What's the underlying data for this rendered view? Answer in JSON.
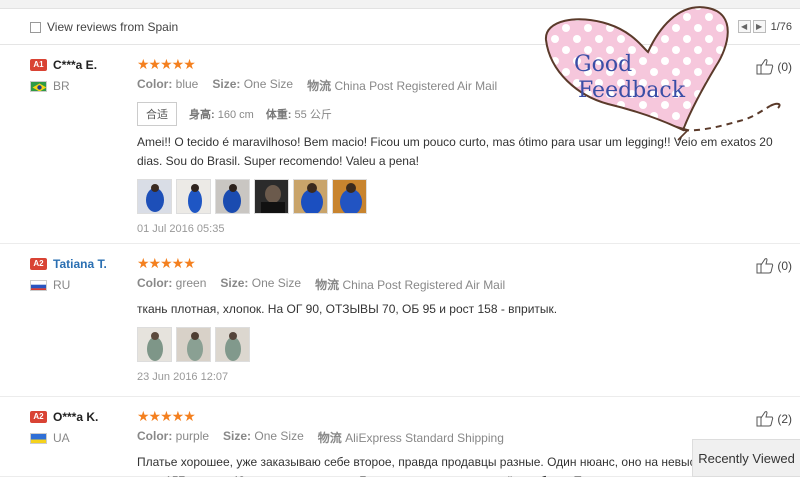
{
  "toolbar": {
    "filter_label": "View reviews from Spain",
    "pager": {
      "prev": "◀",
      "next": "▶",
      "info": "1/76"
    }
  },
  "overlay": {
    "line1": "Good",
    "line2": "Feedback"
  },
  "reviews": [
    {
      "level": "A1",
      "name": "C***a E.",
      "country": "BR",
      "stars": "★★★★★",
      "color_label": "Color:",
      "color_value": "blue",
      "size_label": "Size:",
      "size_value": "One Size",
      "logistics_label": "物流",
      "logistics_value": "China Post Registered Air Mail",
      "fit": "合适",
      "height_label": "身高:",
      "height_value": "160 cm",
      "weight_label": "体重:",
      "weight_value": "55 公斤",
      "text": "Amei!! O tecido é maravilhoso! Bem macio! Ficou um pouco curto, mas ótimo para usar um legging!! Veio em exatos 20 dias. Sou do Brasil. Super recomendo! Valeu a pena!",
      "date": "01 Jul 2016 05:35",
      "helpful": "(0)"
    },
    {
      "level": "A2",
      "name": "Tatiana T.",
      "country": "RU",
      "stars": "★★★★★",
      "color_label": "Color:",
      "color_value": "green",
      "size_label": "Size:",
      "size_value": "One Size",
      "logistics_label": "物流",
      "logistics_value": "China Post Registered Air Mail",
      "text": "ткань плотная, хлопок. На ОГ 90, ОТЗЫВЫ 70, ОБ 95 и рост 158 - впритык.",
      "date": "23 Jun 2016 12:07",
      "helpful": "(0)"
    },
    {
      "level": "A2",
      "name": "O***a K.",
      "country": "UA",
      "stars": "★★★★★",
      "color_label": "Color:",
      "color_value": "purple",
      "size_label": "Size:",
      "size_value": "One Size",
      "logistics_label": "物流",
      "logistics_value": "AliExpress Standard Shipping",
      "text": "Платье хорошее, уже заказываю себе второе, правда продавцы разные. Один нюанс, оно на невысоких девушек, рост 157 см, вес 48 кг- платье впритык. Будьте внимательны в своём выборе. Продавца и товар рекоме",
      "helpful": "(2)"
    }
  ],
  "recently_viewed": "Recently Viewed",
  "colors": {
    "star": "#f4801f",
    "level": "#d94334",
    "name_link": "#2a6fb2",
    "overlay_text": "#3a4ea6",
    "heart_fill": "#f6c7dc"
  }
}
